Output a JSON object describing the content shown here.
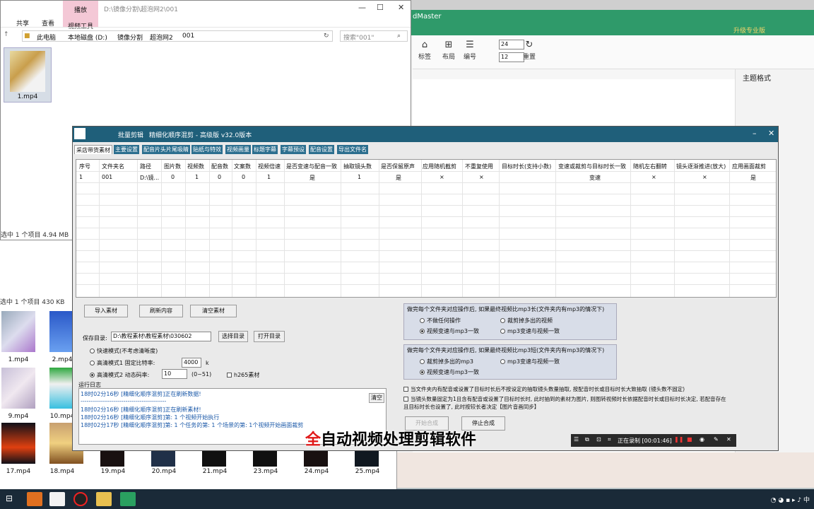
{
  "mindmaster": {
    "title": "dMaster",
    "upgrade": "升级专业版",
    "ribbon": [
      {
        "label": "标签",
        "icon": "tag-icon"
      },
      {
        "label": "布局",
        "icon": "layout-icon"
      },
      {
        "label": "编号",
        "icon": "numbering-icon"
      },
      {
        "label": "重置",
        "icon": "reset-icon"
      }
    ],
    "spin1": "24",
    "spin2": "12",
    "theme_label": "主题格式"
  },
  "explorer": {
    "path_title": "D:\\镜像分割\\超泡网2\\001",
    "play_tab": "播放",
    "video_tools": "视频工具",
    "tabs": [
      "共享",
      "查看"
    ],
    "breadcrumbs": [
      "此电脑",
      "本地磁盘 (D:)",
      "镜像分割",
      "超泡网2",
      "001"
    ],
    "search_placeholder": "搜索\"001\"",
    "file_name": "1.mp4",
    "status": "选中 1 个项目  4.94 MB"
  },
  "explorer2": {
    "status": "选中 1 个项目  430 KB",
    "files": [
      "1.mp4",
      "2.mp4",
      "9.mp4",
      "10.mp4",
      "17.mp4",
      "18.mp4",
      "19.mp4",
      "20.mp4",
      "21.mp4",
      "23.mp4",
      "24.mp4",
      "25.mp4"
    ]
  },
  "dialog": {
    "title_short": "批量剪辑",
    "title": "精细化顺序混剪 - 高级版  v32.0版本",
    "tabs": [
      "采店带货素材",
      "主要设置",
      "配音片头片尾吸睛",
      "贴纸与特效",
      "视频画量",
      "标题字幕",
      "字幕预设",
      "配音设置",
      "导出文件名"
    ],
    "grid_headers": [
      "序号",
      "文件夹名",
      "路径",
      "图片数",
      "视频数",
      "配音数",
      "文案数",
      "视频倍速",
      "是否变速与配音一致",
      "抽取镜头数",
      "是否保留原声",
      "应用随机截剪",
      "不重复使用",
      "目标时长(支持小数)",
      "变速或裁剪与目标时长一致",
      "随机左右翻转",
      "镜头逐渐推进(放大)",
      "应用画面裁剪"
    ],
    "grid_row": [
      "1",
      "001",
      "D:\\镜...",
      "0",
      "1",
      "0",
      "0",
      "1",
      "是",
      "1",
      "是",
      "×",
      "×",
      "",
      "变速",
      "×",
      "×",
      "是"
    ],
    "btn_import": "导入素材",
    "btn_refresh": "刷新内容",
    "btn_clear": "清空素材",
    "save_dir_label": "保存目录:",
    "save_dir_value": "D:\\教程素材\\教程素材\\030602",
    "btn_choose_dir": "选择目录",
    "btn_open_dir": "打开目录",
    "mode_fast": "快速模式(不考虑清晰度)",
    "mode_hd1": "高清模式1 固定比特率:",
    "mode_hd1_value": "4000",
    "mode_hd1_unit": "k",
    "mode_hd2": "高清模式2 动态码率:",
    "mode_hd2_value": "10",
    "mode_hd2_range": "(0~51)",
    "h265": "h265素材",
    "log_label": "运行日志",
    "log_clear": "清空",
    "log_lines": [
      "18时02分16秒 [精细化顺序混剪]正在刷新数据!",
      "------------------------------------------",
      "18时02分16秒 [精细化顺序混剪]正在刷新素材!",
      "18时02分16秒 [精细化顺序混剪]第: 1 个视频开始执行",
      "18时02分17秒 [精细化顺序混剪]第: 1 个任务的第: 1 个场景的第: 1个视频开始画面裁剪"
    ],
    "group1_title": "做完每个文件夹对应操作后, 如果最终视频比mp3长(文件夹内有mp3的情况下)",
    "group1_opts": [
      "不做任何操作",
      "裁剪掉多出的视频",
      "视频变速与mp3一致",
      "mp3变速与视频一致"
    ],
    "group2_title": "做完每个文件夹对应操作后, 如果最终视频比mp3短(文件夹内有mp3的情况下)",
    "group2_opts": [
      "裁剪掉多出的mp3",
      "mp3变速与视频一致",
      "视频变速与mp3一致"
    ],
    "chk1": "当文件夹内有配音或设置了目标时长后不按设定的抽取镜头数量抽取, 按配音时长或目标时长大致抽取 (镜头数不固定)",
    "chk2": "当镜头数量固定为1且含有配音或设置了目标时长时, 此时抽到的素材为图片, 则图转视频时长依据配音时长或目标时长决定, 若配音存在且目标时长也设置了, 此时按较长者决定【图片音画同步】",
    "btn_start": "开始合成",
    "btn_stop": "停止合成"
  },
  "subtitle": {
    "red": "全",
    "rest": "自动视频处理剪辑软件"
  },
  "recorder": {
    "status": "正在录制 [00:01:46]"
  },
  "taskbar": {
    "ime": "中"
  }
}
